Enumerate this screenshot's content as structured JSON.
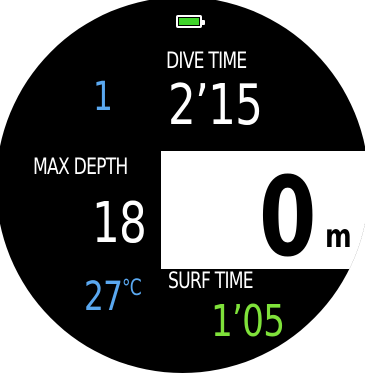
{
  "status": {
    "battery_icon": "battery-full-icon",
    "battery_color": "#3fd32a"
  },
  "dive": {
    "number": "1",
    "time_label": "DIVE TIME",
    "time_value": "2’15"
  },
  "max_depth": {
    "label": "MAX DEPTH",
    "value": "18"
  },
  "depth": {
    "value": "0",
    "unit": "m"
  },
  "temperature": {
    "value": "27",
    "unit": "°C"
  },
  "surface": {
    "label": "SURF TIME",
    "value": "1’05"
  },
  "colors": {
    "accent_blue": "#5aa8f0",
    "accent_green": "#7fe23a",
    "background": "#000000"
  }
}
